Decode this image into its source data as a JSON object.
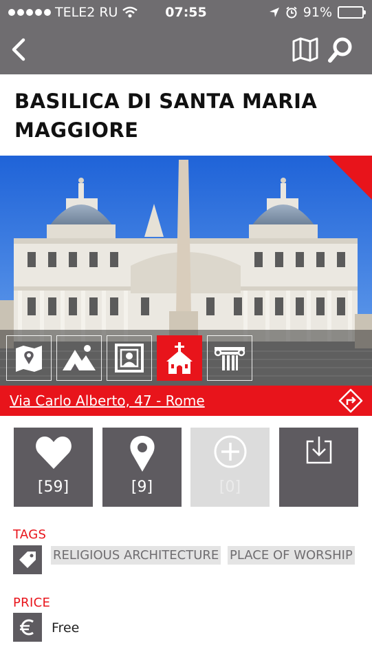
{
  "status_bar": {
    "carrier": "TELE2 RU",
    "time": "07:55",
    "battery": "91%",
    "battery_level": 0.91,
    "signal_bars": 5
  },
  "header": {
    "back_icon": "chevron-left-icon",
    "map_icon": "map-icon",
    "search_icon": "search-icon"
  },
  "title": "BASILICA DI SANTA MARIA MAGGIORE",
  "categories": [
    {
      "icon": "map-pin-map-icon",
      "active": false
    },
    {
      "icon": "mountain-icon",
      "active": false
    },
    {
      "icon": "portrait-frame-icon",
      "active": false
    },
    {
      "icon": "church-icon",
      "active": true
    },
    {
      "icon": "column-icon",
      "active": false
    }
  ],
  "address": {
    "text": "Via Carlo Alberto, 47  - Rome",
    "route_icon": "route-direction-icon"
  },
  "actions": [
    {
      "icon": "heart-icon",
      "count": "[59]",
      "enabled": true
    },
    {
      "icon": "location-pin-icon",
      "count": "[9]",
      "enabled": true
    },
    {
      "icon": "add-circle-icon",
      "count": "[0]",
      "enabled": false
    },
    {
      "icon": "download-icon",
      "count": "",
      "enabled": true
    }
  ],
  "tags": {
    "label": "TAGS",
    "icon": "tag-icon",
    "items": [
      "RELIGIOUS ARCHITECTURE",
      "PLACE OF WORSHIP"
    ]
  },
  "price": {
    "label": "PRICE",
    "icon": "euro-icon",
    "value": "Free"
  },
  "colors": {
    "accent": "#e8141b",
    "header": "#6f6d70",
    "tile": "#5e5b60",
    "tile_disabled": "#dcdcdc"
  }
}
